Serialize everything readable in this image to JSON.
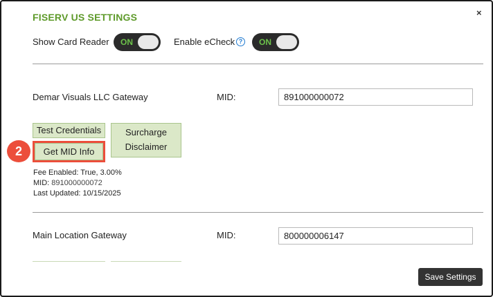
{
  "dialog": {
    "title": "FISERV US SETTINGS",
    "close_label": "×"
  },
  "toggles": [
    {
      "label": "Show Card Reader",
      "state": "ON"
    },
    {
      "label": "Enable eCheck",
      "state": "ON",
      "help": "?"
    }
  ],
  "gateways": [
    {
      "name": "Demar Visuals LLC Gateway",
      "mid_label": "MID:",
      "mid_value": "891000000072",
      "buttons": {
        "test_credentials": "Test Credentials",
        "surcharge_line1": "Surcharge",
        "surcharge_line2": "Disclaimer",
        "get_mid_info": "Get MID Info"
      },
      "info": {
        "fee": "Fee Enabled: True, 3.00%",
        "mid_prefix": "MID: ",
        "mid": "891000000072",
        "updated": "Last Updated: 10/15/2025"
      }
    },
    {
      "name": "Main Location Gateway",
      "mid_label": "MID:",
      "mid_value": "800000006147"
    }
  ],
  "annotation": {
    "step": "2"
  },
  "footer": {
    "save_label": "Save Settings"
  },
  "colors": {
    "title": "#5e9a2a",
    "toggle_on": "#6cc24a",
    "button_bg": "#dbe8c8",
    "highlight": "#ec4e3b"
  }
}
